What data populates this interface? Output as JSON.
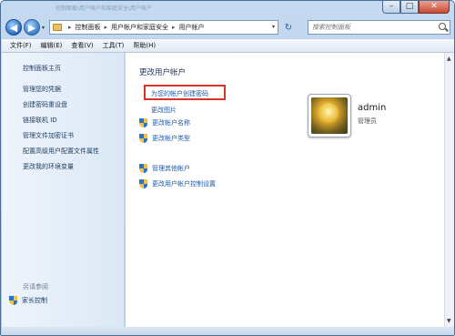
{
  "window": {
    "title": "控制面板\\用户帐户和家庭安全\\用户帐户"
  },
  "address_bar": {
    "crumbs": [
      "控制面板",
      "用户帐户和家庭安全",
      "用户帐户"
    ]
  },
  "search": {
    "placeholder": "搜索控制面板"
  },
  "menu": {
    "items": [
      "文件(F)",
      "编辑(E)",
      "查看(V)",
      "工具(T)",
      "帮助(H)"
    ]
  },
  "sidebar": {
    "items": [
      "控制面板主页",
      "管理您的凭据",
      "创建密码重设盘",
      "链接联机 ID",
      "管理文件加密证书",
      "配置高级用户配置文件属性",
      "更改我的环境变量"
    ],
    "see_also_label": "另请参阅",
    "parental_controls": "家长控制"
  },
  "main": {
    "heading": "更改用户帐户",
    "tasks": {
      "create_password": "为您的帐户创建密码",
      "change_picture": "更改图片",
      "change_name": "更改帐户名称",
      "change_type": "更改帐户类型",
      "manage_other": "管理其他帐户",
      "uac_settings": "更改用户帐户控制设置"
    }
  },
  "user": {
    "name": "admin",
    "role": "管理员"
  },
  "colors": {
    "highlight_box": "#d8342a",
    "link": "#1c5aa6"
  }
}
